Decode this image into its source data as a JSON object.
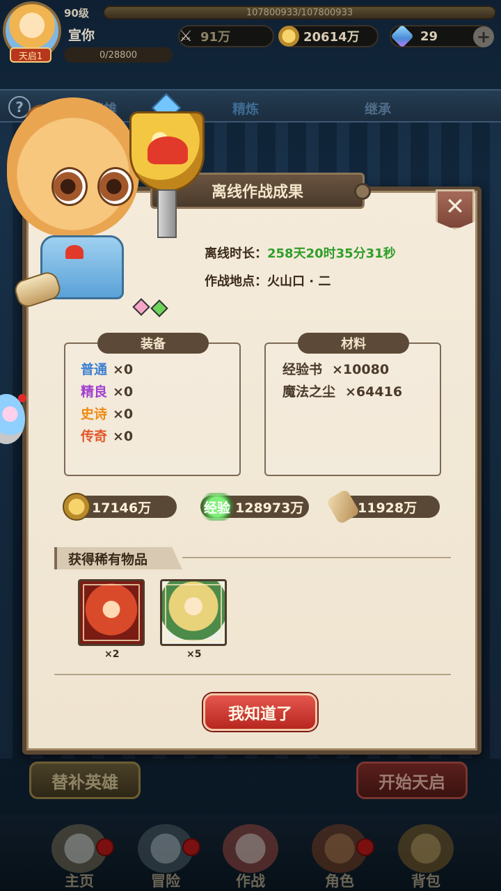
{
  "player": {
    "level": "90级",
    "name": "宣你",
    "tag": "天启1",
    "hp_text": "107800933/107800933",
    "exp_text": "0/28800"
  },
  "resources": {
    "power": "91万",
    "gold": "20614万",
    "gems": "29"
  },
  "tabs": [
    {
      "label": "英雄"
    },
    {
      "label": "精炼"
    },
    {
      "label": "继承"
    }
  ],
  "dialog": {
    "title": "离线作战成果",
    "duration_label": "离线时长：",
    "duration_value": "258天20时35分31秒",
    "location_label": "作战地点：",
    "location_value": "火山口 · 二",
    "equipment": {
      "title": "装备",
      "items": [
        {
          "name": "普通",
          "count": "×0",
          "color": "#3d7fd1"
        },
        {
          "name": "精良",
          "count": "×0",
          "color": "#a23fd0"
        },
        {
          "name": "史诗",
          "count": "×0",
          "color": "#ee8a12"
        },
        {
          "name": "传奇",
          "count": "×0",
          "color": "#e2582a"
        }
      ]
    },
    "materials": {
      "title": "材料",
      "items": [
        {
          "name": "经验书",
          "count": "×10080"
        },
        {
          "name": "魔法之尘",
          "count": "×64416"
        }
      ]
    },
    "rewards": {
      "gold": "17146万",
      "exp_icon": "经验",
      "exp": "128973万",
      "scroll": "11928万"
    },
    "rare_title": "获得稀有物品",
    "rare_items": [
      {
        "count": "×2"
      },
      {
        "count": "×5"
      }
    ],
    "ok_button": "我知道了"
  },
  "buttons": {
    "substitute": "替补英雄",
    "start": "开始天启"
  },
  "nav": [
    {
      "label": "主页"
    },
    {
      "label": "冒险"
    },
    {
      "label": "作战"
    },
    {
      "label": "角色"
    },
    {
      "label": "背包"
    }
  ],
  "colors": {
    "duration_green": "#2f9e2a",
    "ok_red": "#c8352c",
    "panel": "#f2e8d6"
  }
}
